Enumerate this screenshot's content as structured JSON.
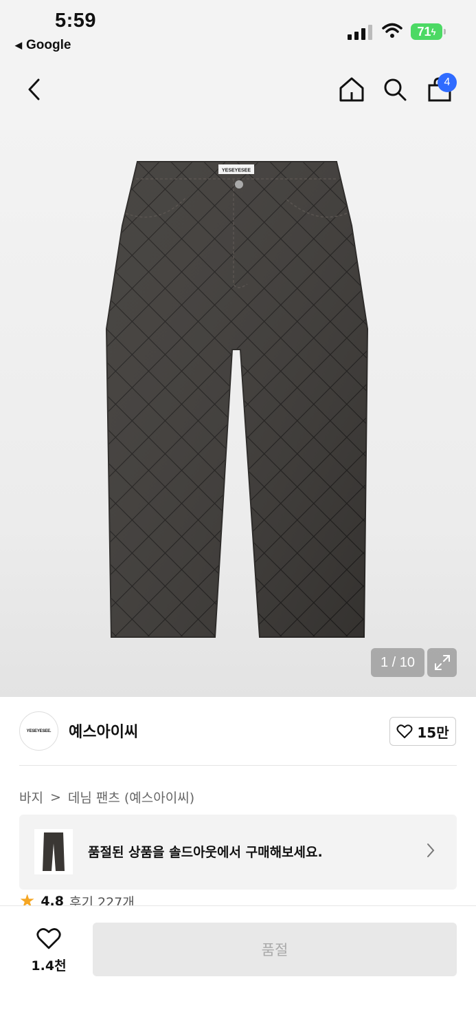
{
  "status_bar": {
    "time": "5:59",
    "back_app": "Google",
    "battery": "71"
  },
  "nav": {
    "cart_count": "4"
  },
  "gallery": {
    "tag_text": "YESEYESEE",
    "pager": "1 / 10"
  },
  "brand": {
    "name": "예스아이씨",
    "logo_text": "YESEYESEE.",
    "likes": "15만"
  },
  "breadcrumb": {
    "category": "바지",
    "separator": ">",
    "subcategory": "데님 팬츠 (예스아이씨)"
  },
  "soldout_banner": {
    "text": "품절된 상품을 솔드아웃에서 구매해보세요."
  },
  "rating": {
    "score": "4.8",
    "reviews": "후기 227개"
  },
  "bottom_bar": {
    "wish_count": "1.4천",
    "buy_label": "품절"
  },
  "colors": {
    "accent": "#2f6bff",
    "battery": "#4cd964",
    "star": "#f5a623"
  }
}
